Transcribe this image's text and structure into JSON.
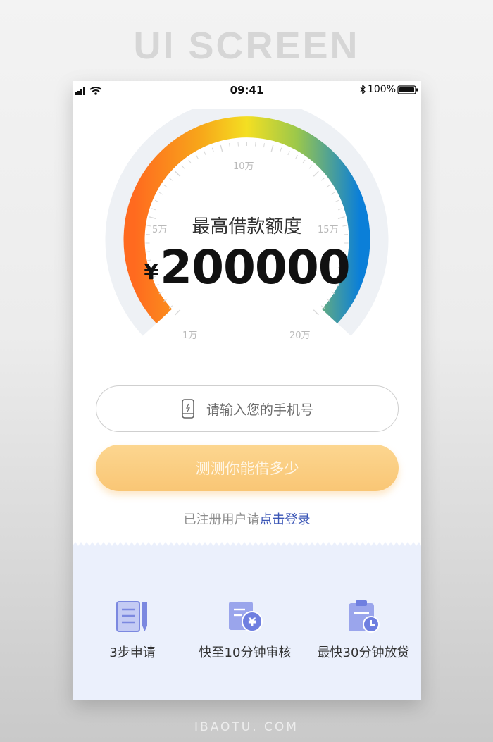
{
  "canvas": {
    "title": "UI SCREEN",
    "footer": "IBAOTU. COM"
  },
  "status_bar": {
    "time": "09:41",
    "battery": "100%"
  },
  "gauge": {
    "title": "最高借款额度",
    "currency": "¥",
    "amount": "200000",
    "tick_labels": [
      "1万",
      "5万",
      "10万",
      "15万",
      "20万"
    ],
    "colors": [
      "#ff6a1f",
      "#f7b21a",
      "#f2e024",
      "#8ec64a",
      "#0b7fd8"
    ]
  },
  "form": {
    "phone_placeholder": "请输入您的手机号",
    "submit_label": "测测你能借多少",
    "login_prompt": "已注册用户请",
    "login_link": "点击登录"
  },
  "steps": [
    {
      "icon": "document-pen-icon",
      "label": "3步申请"
    },
    {
      "icon": "yuan-document-icon",
      "label": "快至10分钟审核"
    },
    {
      "icon": "clipboard-clock-icon",
      "label": "最快30分钟放贷"
    }
  ],
  "theme": {
    "accent": "#3b56b6",
    "button": "#fbcd82",
    "panel": "#ebf0fc",
    "icon": "#8e9ae6"
  }
}
